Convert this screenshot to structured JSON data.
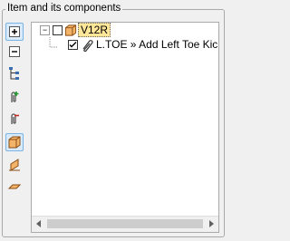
{
  "panel": {
    "title": "Item and its components"
  },
  "toolbar": [
    {
      "name": "expand-all-icon",
      "active": true
    },
    {
      "name": "collapse-all-icon",
      "active": false
    },
    {
      "name": "tree-structure-icon",
      "active": false
    },
    {
      "name": "add-component-icon",
      "active": false
    },
    {
      "name": "remove-component-icon",
      "active": false
    },
    {
      "name": "box-3d-icon",
      "active": true
    },
    {
      "name": "side-face-icon",
      "active": false
    },
    {
      "name": "flat-face-icon",
      "active": false
    }
  ],
  "tree": {
    "root": {
      "label": "V12R",
      "expander": "−",
      "checked": false,
      "selected": true
    },
    "children": [
      {
        "label": "L.TOE » Add Left Toe Kick",
        "checked": true
      }
    ]
  }
}
